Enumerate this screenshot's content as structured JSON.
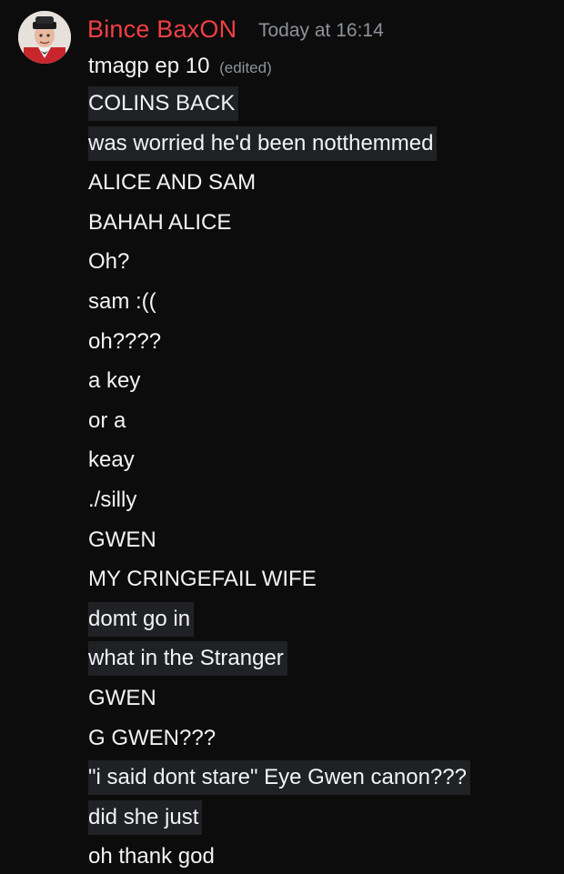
{
  "author": {
    "name": "Bince BaxON",
    "timestamp": "Today at 16:14"
  },
  "first_line": {
    "text": "tmagp ep 10",
    "edited": "(edited)"
  },
  "messages": [
    {
      "text": "COLINS BACK",
      "highlight": true
    },
    {
      "text": "was worried he'd been notthemmed",
      "highlight": true
    },
    {
      "text": "ALICE AND SAM",
      "highlight": false
    },
    {
      "text": "BAHAH ALICE",
      "highlight": false
    },
    {
      "text": "Oh?",
      "highlight": false
    },
    {
      "text": "sam :((",
      "highlight": false
    },
    {
      "text": "oh????",
      "highlight": false
    },
    {
      "text": "a key",
      "highlight": false
    },
    {
      "text": "or a",
      "highlight": false
    },
    {
      "text": "keay",
      "highlight": false
    },
    {
      "text": "./silly",
      "highlight": false
    },
    {
      "text": "GWEN",
      "highlight": false
    },
    {
      "text": "MY CRINGEFAIL WIFE",
      "highlight": false
    },
    {
      "text": "domt go in",
      "highlight": true
    },
    {
      "text": "what in the Stranger",
      "highlight": true
    },
    {
      "text": "GWEN",
      "highlight": false
    },
    {
      "text": "G GWEN???",
      "highlight": false
    },
    {
      "text": "\"i said dont stare\" Eye Gwen canon???",
      "highlight": true
    },
    {
      "text": "did she just",
      "highlight": true
    },
    {
      "text": "oh thank god",
      "highlight": false
    }
  ]
}
